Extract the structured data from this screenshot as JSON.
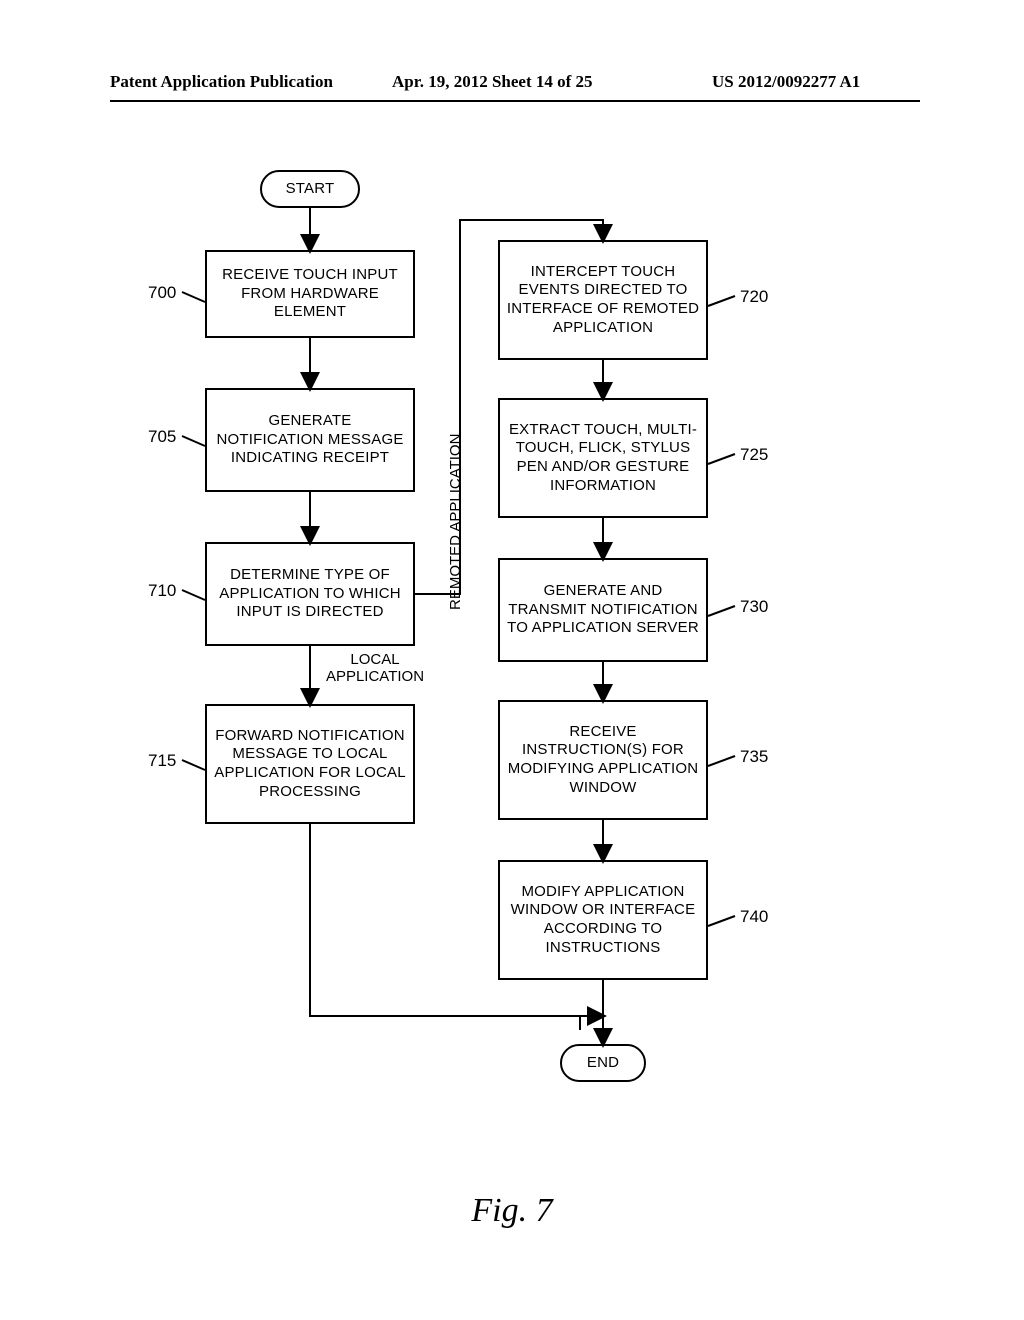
{
  "header": {
    "left": "Patent Application Publication",
    "mid": "Apr. 19, 2012  Sheet 14 of 25",
    "right": "US 2012/0092277 A1"
  },
  "caption": "Fig. 7",
  "nodes": {
    "start": "START",
    "n700": "RECEIVE TOUCH INPUT FROM HARDWARE ELEMENT",
    "n705": "GENERATE NOTIFICATION MESSAGE INDICATING RECEIPT",
    "n710": "DETERMINE TYPE OF APPLICATION TO WHICH INPUT IS DIRECTED",
    "n715": "FORWARD NOTIFICATION MESSAGE TO LOCAL APPLICATION FOR LOCAL PROCESSING",
    "n720": "INTERCEPT TOUCH EVENTS DIRECTED TO INTERFACE OF REMOTED APPLICATION",
    "n725": "EXTRACT TOUCH, MULTI-TOUCH, FLICK, STYLUS PEN AND/OR GESTURE INFORMATION",
    "n730": "GENERATE AND TRANSMIT NOTIFICATION TO APPLICATION SERVER",
    "n735": "RECEIVE INSTRUCTION(S) FOR MODIFYING APPLICATION WINDOW",
    "n740": "MODIFY APPLICATION WINDOW OR INTERFACE ACCORDING TO INSTRUCTIONS",
    "end": "END"
  },
  "refs": {
    "r700": "700",
    "r705": "705",
    "r710": "710",
    "r715": "715",
    "r720": "720",
    "r725": "725",
    "r730": "730",
    "r735": "735",
    "r740": "740"
  },
  "labels": {
    "local_branch": "LOCAL APPLICATION",
    "remoted_branch": "REMOTED APPLICATION"
  }
}
